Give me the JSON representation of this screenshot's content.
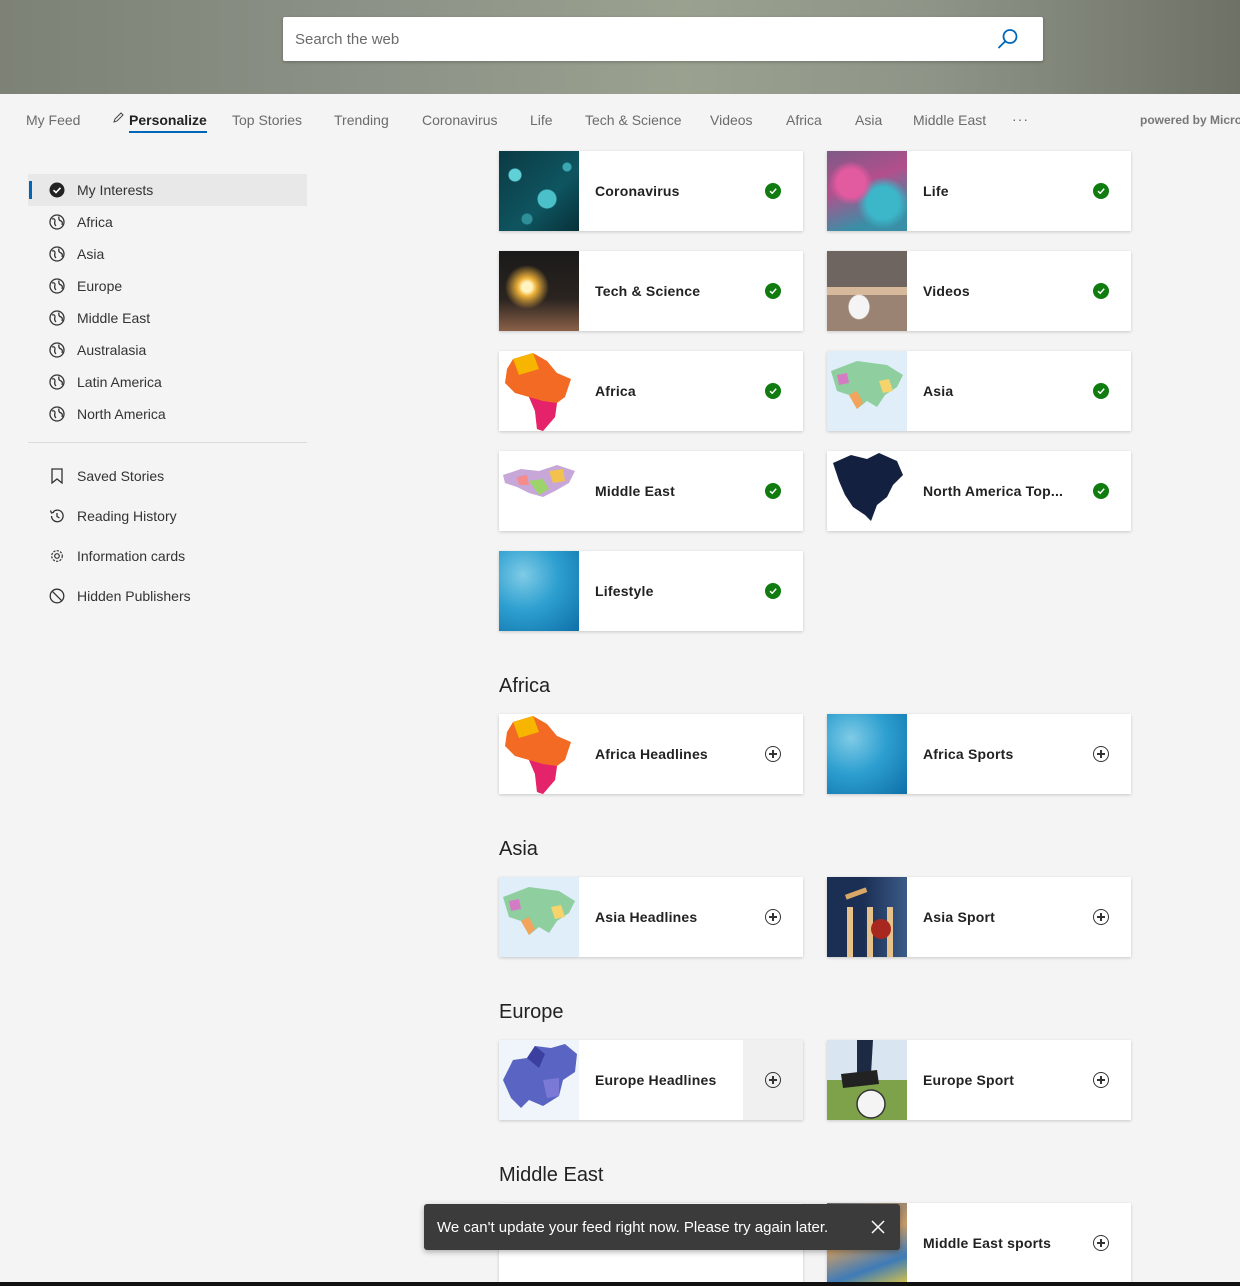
{
  "search": {
    "placeholder": "Search the web"
  },
  "nav": {
    "tabs": [
      "My Feed",
      "Personalize",
      "Top Stories",
      "Trending",
      "Coronavirus",
      "Life",
      "Tech & Science",
      "Videos",
      "Africa",
      "Asia",
      "Middle East"
    ],
    "active_tab": "Personalize",
    "more": "···",
    "powered_by": "powered by Micro"
  },
  "sidebar": {
    "regions": [
      "My Interests",
      "Africa",
      "Asia",
      "Europe",
      "Middle East",
      "Australasia",
      "Latin America",
      "North America"
    ],
    "utilities": [
      "Saved Stories",
      "Reading History",
      "Information cards",
      "Hidden Publishers"
    ]
  },
  "interests": [
    {
      "label": "Coronavirus",
      "image": "virus-image",
      "state": "followed"
    },
    {
      "label": "Life",
      "image": "abstract-face-image",
      "state": "followed"
    },
    {
      "label": "Tech & Science",
      "image": "lightbulb-image",
      "state": "followed"
    },
    {
      "label": "Videos",
      "image": "cup-tv-image",
      "state": "followed"
    },
    {
      "label": "Africa",
      "image": "africa-map-image",
      "state": "followed"
    },
    {
      "label": "Asia",
      "image": "asia-map-image",
      "state": "followed"
    },
    {
      "label": "Middle East",
      "image": "middle-east-map-image",
      "state": "followed"
    },
    {
      "label": "North America Top...",
      "image": "north-america-map-image",
      "state": "followed"
    },
    {
      "label": "Lifestyle",
      "image": "blue-gradient-image",
      "state": "followed"
    }
  ],
  "sections": [
    {
      "title": "Africa",
      "cards": [
        {
          "label": "Africa Headlines",
          "image": "africa-map-image",
          "state": "add"
        },
        {
          "label": "Africa Sports",
          "image": "blue-gradient-image",
          "state": "add"
        }
      ]
    },
    {
      "title": "Asia",
      "cards": [
        {
          "label": "Asia Headlines",
          "image": "asia-map-image",
          "state": "add"
        },
        {
          "label": "Asia Sport",
          "image": "cricket-image",
          "state": "add"
        }
      ]
    },
    {
      "title": "Europe",
      "cards": [
        {
          "label": "Europe Headlines",
          "image": "europe-map-image",
          "state": "add"
        },
        {
          "label": "Europe Sport",
          "image": "soccer-image",
          "state": "add"
        }
      ]
    },
    {
      "title": "Middle East",
      "cards": [
        {
          "label": "Middle East sports",
          "image": "athlete-image",
          "state": "add"
        }
      ]
    }
  ],
  "toast": {
    "message": "We can't update your feed right now. Please try again later."
  },
  "colors": {
    "accent": "#0067b8",
    "followed": "#107c10",
    "toast_bg": "#3b3b3b"
  },
  "icons": [
    "search-icon",
    "pencil-icon",
    "more-icon",
    "check-circle-icon",
    "globe-icon",
    "bookmark-icon",
    "history-icon",
    "gear-icon",
    "block-icon",
    "plus-circle-icon",
    "close-icon"
  ]
}
